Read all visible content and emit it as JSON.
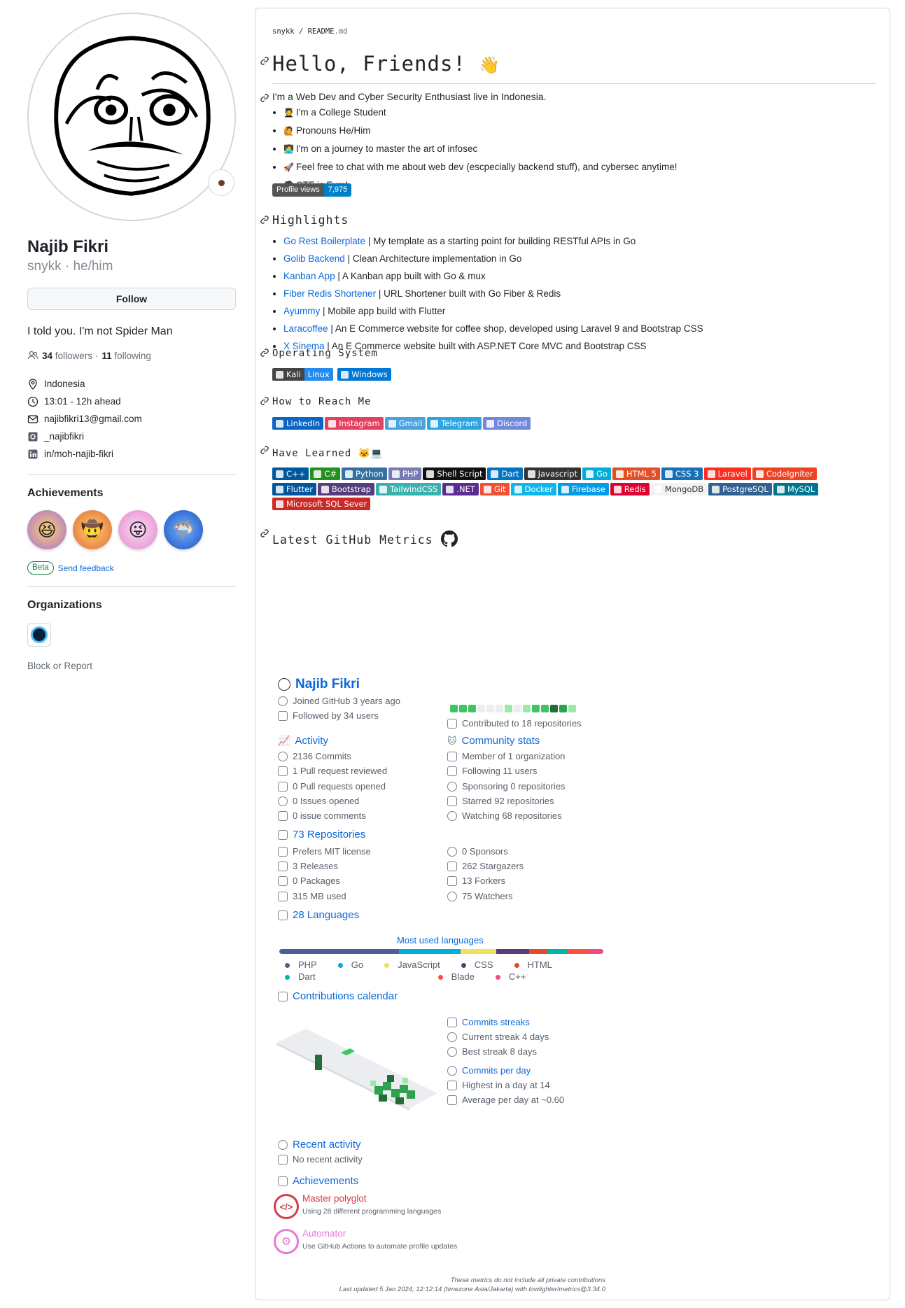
{
  "profile": {
    "name": "Najib Fikri",
    "login_line": "snykk · he/him",
    "follow_label": "Follow",
    "bio": "I told you. I'm not Spider Man",
    "followers_count": "34",
    "followers_label": "followers ·",
    "following_count": "11",
    "following_label": "following",
    "location": "Indonesia",
    "time": "13:01 - 12h ahead",
    "email": "najibfikri13@gmail.com",
    "instagram": "_najibfikri",
    "linkedin": "in/moh-najib-fikri",
    "achievements_heading": "Achievements",
    "beta_label": "Beta",
    "feedback_label": "Send feedback",
    "organizations_heading": "Organizations",
    "block_label": "Block or Report"
  },
  "readme": {
    "crumb_user": "snykk",
    "crumb_sep": "/",
    "crumb_file": "README",
    "crumb_ext": ".md",
    "title": "Hello, Friends!",
    "title_emoji": "👋",
    "intro": "I'm a Web Dev and Cyber Security Enthusiast live in Indonesia.",
    "about": [
      {
        "emoji": "🧑‍🎓",
        "text": "I'm a College Student"
      },
      {
        "emoji": "🙋",
        "text": "Pronouns He/Him"
      },
      {
        "emoji": "🧑‍💻",
        "text": "I'm on a journey to master the art of infosec"
      },
      {
        "emoji": "🚀",
        "text": "Feel free to chat with me about web dev (escpecially backend stuff), and cybersec anytime!"
      },
      {
        "emoji": "🧑",
        "text": "CTF is Fum!"
      }
    ],
    "profile_views_label": "Profile views",
    "profile_views_value": "7,975",
    "highlights_heading": "Highlights",
    "highlights": [
      {
        "link": "Go Rest Boilerplate",
        "desc": " | My template as a starting point for building RESTful APIs in Go"
      },
      {
        "link": "Golib Backend",
        "desc": " | Clean Architecture implementation in Go"
      },
      {
        "link": "Kanban App",
        "desc": " | A Kanban app built with Go & mux"
      },
      {
        "link": "Fiber Redis Shortener",
        "desc": " | URL Shortener built with Go Fiber & Redis"
      },
      {
        "link": "Ayummy",
        "desc": " | Mobile app build with Flutter"
      },
      {
        "link": "Laracoffee",
        "desc": " | An E Commerce website for coffee shop, developed using Laravel 9 and Bootstrap CSS"
      },
      {
        "link": "X Sinema",
        "desc": " | An E Commerce website built with ASP.NET Core MVC and Bootstrap CSS"
      }
    ],
    "os_heading": "Operating System",
    "os_kali": "Kali",
    "os_linux": "Linux",
    "os_windows": "Windows",
    "reach_heading": "How to Reach Me",
    "reach": [
      {
        "label": "LinkedIn",
        "color": "#0a66c2"
      },
      {
        "label": "Instagram",
        "color": "#e4405f"
      },
      {
        "label": "Gmail",
        "color": "#4aa3df"
      },
      {
        "label": "Telegram",
        "color": "#2ca5e0"
      },
      {
        "label": "Discord",
        "color": "#7289da"
      }
    ],
    "learned_heading": "Have Learned",
    "learned_row1": [
      {
        "label": "C++",
        "color": "#00599c"
      },
      {
        "label": "C#",
        "color": "#239120"
      },
      {
        "label": "Python",
        "color": "#3670a0"
      },
      {
        "label": "PHP",
        "color": "#777bb4"
      },
      {
        "label": "Shell Script",
        "color": "#121011"
      },
      {
        "label": "Dart",
        "color": "#0175c2"
      },
      {
        "label": "Javascript",
        "color": "#323330"
      },
      {
        "label": "Go",
        "color": "#00add8"
      },
      {
        "label": "HTML 5",
        "color": "#e34f26"
      },
      {
        "label": "CSS 3",
        "color": "#1572b6"
      },
      {
        "label": "Laravel",
        "color": "#ff2d20"
      },
      {
        "label": "CodeIgniter",
        "color": "#ef4223"
      }
    ],
    "learned_row2": [
      {
        "label": "Flutter",
        "color": "#02569b"
      },
      {
        "label": "Bootstrap",
        "color": "#563d7c"
      },
      {
        "label": "TailwindCSS",
        "color": "#38b2ac"
      },
      {
        "label": ".NET",
        "color": "#5c2d91"
      },
      {
        "label": "Git",
        "color": "#f05033"
      },
      {
        "label": "Docker",
        "color": "#0db7ed"
      },
      {
        "label": "Firebase",
        "color": "#039be5"
      },
      {
        "label": "Redis",
        "color": "#dd0031"
      },
      {
        "label": "MongoDB",
        "color": "#f2f2f2"
      },
      {
        "label": "PostgreSQL",
        "color": "#316192"
      },
      {
        "label": "MySQL",
        "color": "#00758f"
      }
    ],
    "learned_row3": [
      {
        "label": "Microsoft SQL Sever",
        "color": "#cc2927"
      }
    ],
    "metrics_heading": "Latest GitHub Metrics"
  },
  "metrics": {
    "user_name": "Najib Fikri",
    "joined": "Joined GitHub 3 years ago",
    "followed_by": "Followed by 34 users",
    "contributed": "Contributed to 18 repositories",
    "activity_heading": "Activity",
    "commits": "2136 Commits",
    "pr_reviewed": "1 Pull request reviewed",
    "pr_opened": "0 Pull requests opened",
    "issues_opened": "0 Issues opened",
    "issue_comments": "0 issue comments",
    "community_heading": "Community stats",
    "member_of": "Member of 1 organization",
    "following": "Following 11 users",
    "sponsoring": "Sponsoring 0 repositories",
    "starred": "Starred 92 repositories",
    "watching": "Watching 68 repositories",
    "repos_heading": "73 Repositories",
    "license": "Prefers MIT license",
    "releases": "3 Releases",
    "packages": "0 Packages",
    "disk": "315 MB used",
    "sponsors": "0 Sponsors",
    "stargazers": "262 Stargazers",
    "forkers": "13 Forkers",
    "watchers": "75 Watchers",
    "languages_heading": "28 Languages",
    "most_used_title": "Most used languages",
    "languages": [
      {
        "name": "PHP",
        "color": "#4f5d95",
        "share": 0.37
      },
      {
        "name": "Go",
        "color": "#00add8",
        "share": 0.19
      },
      {
        "name": "JavaScript",
        "color": "#f1e05a",
        "share": 0.11
      },
      {
        "name": "CSS",
        "color": "#563d7c",
        "share": 0.1
      },
      {
        "name": "HTML",
        "color": "#e34c26",
        "share": 0.06
      },
      {
        "name": "Dart",
        "color": "#00b4ab",
        "share": 0.06
      },
      {
        "name": "Blade",
        "color": "#f7523f",
        "share": 0.06
      },
      {
        "name": "C++",
        "color": "#f34b7d",
        "share": 0.05
      }
    ],
    "contrib_colors": [
      "#40c463",
      "#40c463",
      "#40c463",
      "#ebedf0",
      "#ebedf0",
      "#ebedf0",
      "#9be9a8",
      "#ebedf0",
      "#9be9a8",
      "#40c463",
      "#40c463",
      "#216e39",
      "#30a14e",
      "#9be9a8"
    ],
    "calendar_heading": "Contributions calendar",
    "streaks_heading": "Commits streaks",
    "current_streak": "Current streak 4 days",
    "best_streak": "Best streak 8 days",
    "per_day_heading": "Commits per day",
    "highest_day": "Highest in a day at 14",
    "average_day": "Average per day at ~0.60",
    "recent_heading": "Recent activity",
    "no_recent": "No recent activity",
    "achievements_heading": "Achievements",
    "ach1_title": "Master polyglot",
    "ach1_desc": "Using 28 different programming languages",
    "ach2_title": "Automator",
    "ach2_desc": "Use GitHub Actions to automate profile updates",
    "foot1": "These metrics do not include all private contributions",
    "foot2": "Last updated 5 Jan 2024, 12:12:14 (timezone Asia/Jakarta) with lowlighter/metrics@3.34.0"
  }
}
